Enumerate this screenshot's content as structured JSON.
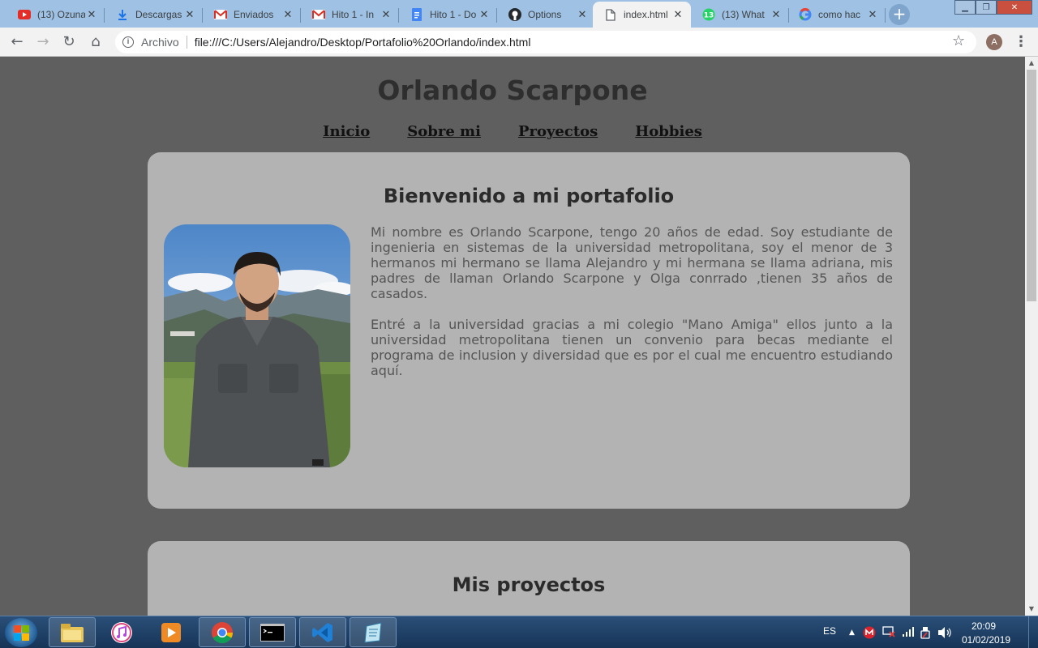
{
  "browser": {
    "tabs": [
      {
        "title": "(13) Ozuna",
        "icon": "youtube-icon",
        "color": "#e52d27"
      },
      {
        "title": "Descargas",
        "icon": "download-icon",
        "color": "#1a73e8"
      },
      {
        "title": "Enviados",
        "icon": "gmail-icon",
        "color": "#d93025"
      },
      {
        "title": "Hito 1 - In",
        "icon": "gmail-icon",
        "color": "#d93025"
      },
      {
        "title": "Hito 1 - Do",
        "icon": "google-docs-icon",
        "color": "#4285f4"
      },
      {
        "title": "Options",
        "icon": "github-icon",
        "color": "#24292e"
      },
      {
        "title": "index.html",
        "icon": "file-icon",
        "color": "#5f6368"
      },
      {
        "title": "(13) What",
        "icon": "whatsapp-icon",
        "color": "#25d366"
      },
      {
        "title": "como hac",
        "icon": "google-icon",
        "color": "#4285f4"
      }
    ],
    "active_tab": 6,
    "address": {
      "label": "Archivo",
      "url": "file:///C:/Users/Alejandro/Desktop/Portafolio%20Orlando/index.html"
    },
    "profile_initial": "A"
  },
  "page": {
    "title": "Orlando Scarpone",
    "nav": [
      "Inicio",
      "Sobre mi",
      "Proyectos",
      "Hobbies"
    ],
    "welcome": {
      "heading": "Bienvenido a mi portafolio",
      "paragraphs": [
        "Mi nombre es Orlando Scarpone, tengo 20 años de edad. Soy estudiante de ingenieria en sistemas de la universidad metropolitana, soy el menor de 3 hermanos mi hermano se llama Alejandro y mi hermana se llama adriana, mis padres de llaman Orlando Scarpone y Olga conrrado ,tienen 35 años de casados.",
        "Entré a la universidad gracias a mi colegio \"Mano Amiga\" ellos junto a la universidad metropolitana tienen un convenio para becas mediante el programa de inclusion y diversidad que es por el cual me encuentro estudiando aquí."
      ]
    },
    "projects": {
      "heading": "Mis proyectos"
    }
  },
  "taskbar": {
    "apps": [
      "file-explorer-icon",
      "itunes-icon",
      "media-player-icon",
      "chrome-icon",
      "command-prompt-icon",
      "vscode-icon",
      "notepad-icon"
    ],
    "language": "ES",
    "time": "20:09",
    "date": "01/02/2019"
  },
  "colors": {
    "page_background": "#5f5f5f",
    "card_background": "#b3b3b3",
    "tabstrip": "#9fc1e3"
  }
}
